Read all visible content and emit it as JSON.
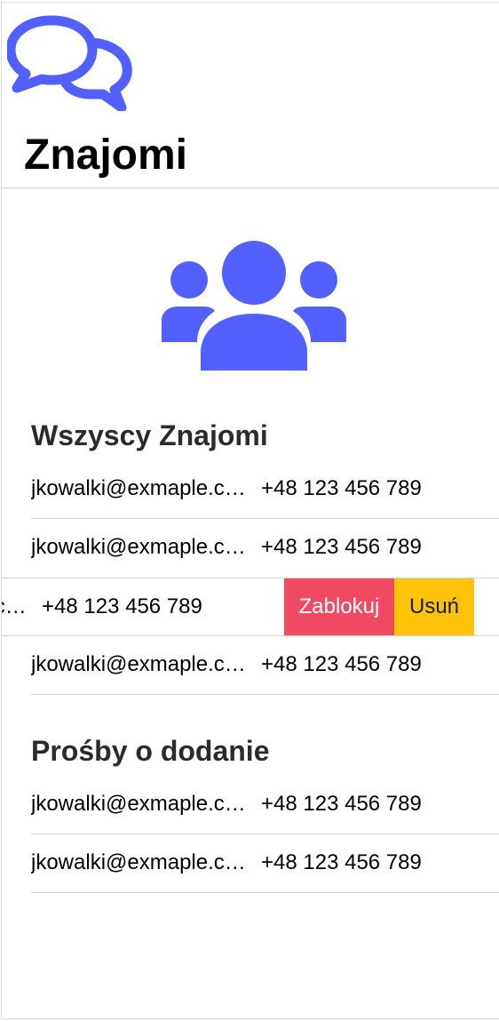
{
  "header": {
    "logo_icon": "chat-bubbles-icon",
    "title": "Znajomi"
  },
  "illustration": {
    "icon": "friends-group-icon",
    "color": "#5260ff"
  },
  "colors": {
    "accent": "#5260ff",
    "danger": "#ef4a61",
    "warning": "#ffc409"
  },
  "all_friends": {
    "title": "Wszyscy Znajomi",
    "items": [
      {
        "email": "jkowalki@exmaple.com",
        "phone": "+48 123 456 789"
      },
      {
        "email": "jkowalki@exmaple.com",
        "phone": "+48 123 456 789"
      },
      {
        "email": "jkowalki@exmaple.com",
        "phone": "+48 123 456 789",
        "swiped": true
      },
      {
        "email": "jkowalki@exmaple.com",
        "phone": "+48 123 456 789"
      }
    ],
    "actions": {
      "block_label": "Zablokuj",
      "remove_label": "Usuń"
    }
  },
  "requests": {
    "title": "Prośby o dodanie",
    "items": [
      {
        "email": "jkowalki@exmaple.com",
        "phone": "+48 123 456 789"
      },
      {
        "email": "jkowalki@exmaple.com",
        "phone": "+48 123 456 789"
      }
    ]
  }
}
